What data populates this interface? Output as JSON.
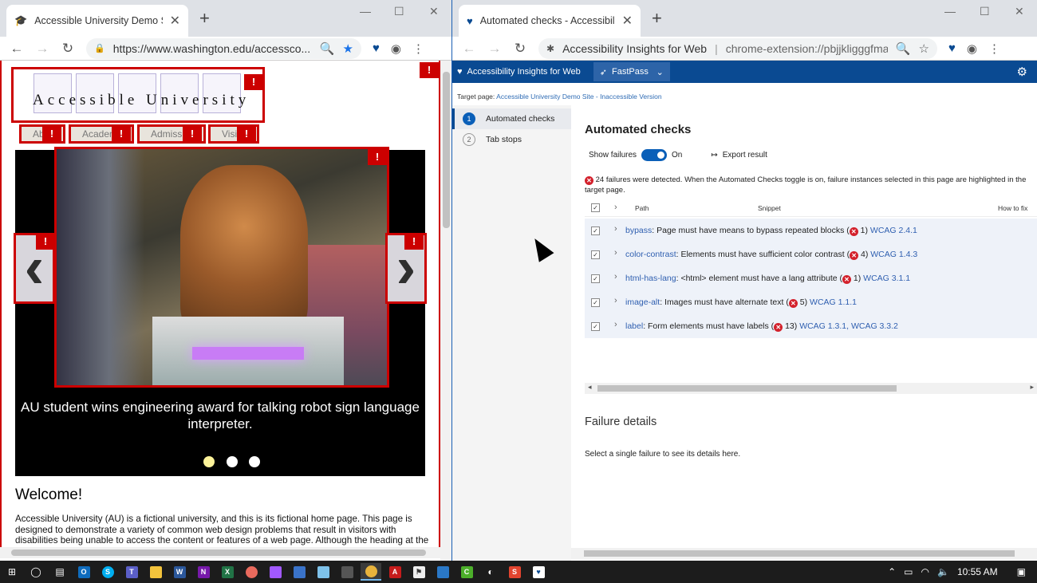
{
  "left_window": {
    "tab_title": "Accessible University Demo Site",
    "url": "https://www.washington.edu/accessco...",
    "page": {
      "logo_text": "Accessible University",
      "flag_symbol": "!",
      "nav_items": [
        "Ab",
        "Acaden",
        "Admiss",
        "Visi"
      ],
      "caption": "AU student wins engineering award for talking robot sign language interpreter.",
      "welcome_heading": "Welcome!",
      "intro_paragraph": "Accessible University (AU) is a fictional university, and this is its fictional home page. This page is designed to demonstrate a variety of common web design problems that result in visitors with disabilities being unable to access the content or features of a web page. Although the heading at the"
    }
  },
  "right_window": {
    "tab_title": "Automated checks - Accessibility",
    "url_app": "Accessibility Insights for Web",
    "url_sep": "|",
    "url": "chrome-extension://pbjjkligggfmak...",
    "app_name": "Accessibility Insights for Web",
    "mode": "FastPass",
    "target_page_label": "Target page:",
    "target_page_link": "Accessible University Demo Site - Inaccessible Version",
    "nav": [
      {
        "num": "1",
        "label": "Automated checks"
      },
      {
        "num": "2",
        "label": "Tab stops"
      }
    ],
    "heading": "Automated checks",
    "toggle_label": "Show failures",
    "toggle_state": "On",
    "export_label": "Export result",
    "failure_message": "24 failures were detected. When the Automated Checks toggle is on, failure instances selected in this page are highlighted in the target page.",
    "columns": {
      "path": "Path",
      "snippet": "Snippet",
      "howto": "How to fix"
    },
    "rules": [
      {
        "id": "bypass",
        "desc": ": Page must have means to bypass repeated blocks (",
        "count": " 1) ",
        "wcag": "WCAG 2.4.1"
      },
      {
        "id": "color-contrast",
        "desc": ": Elements must have sufficient color contrast (",
        "count": " 4) ",
        "wcag": "WCAG 1.4.3"
      },
      {
        "id": "html-has-lang",
        "desc": ": <html> element must have a lang attribute (",
        "count": " 1) ",
        "wcag": "WCAG 3.1.1"
      },
      {
        "id": "image-alt",
        "desc": ": Images must have alternate text (",
        "count": " 5) ",
        "wcag": "WCAG 1.1.1"
      },
      {
        "id": "label",
        "desc": ": Form elements must have labels (",
        "count": " 13) ",
        "wcag": "WCAG 1.3.1, WCAG 3.3.2"
      }
    ],
    "failure_details_title": "Failure details",
    "failure_details_text": "Select a single failure to see its details here."
  },
  "taskbar": {
    "time": "10:55 AM"
  },
  "colors": {
    "flag_red": "#cc0000",
    "insights_blue": "#0a4a92",
    "error_red": "#d3212c",
    "link_blue": "#2f5fb0"
  }
}
